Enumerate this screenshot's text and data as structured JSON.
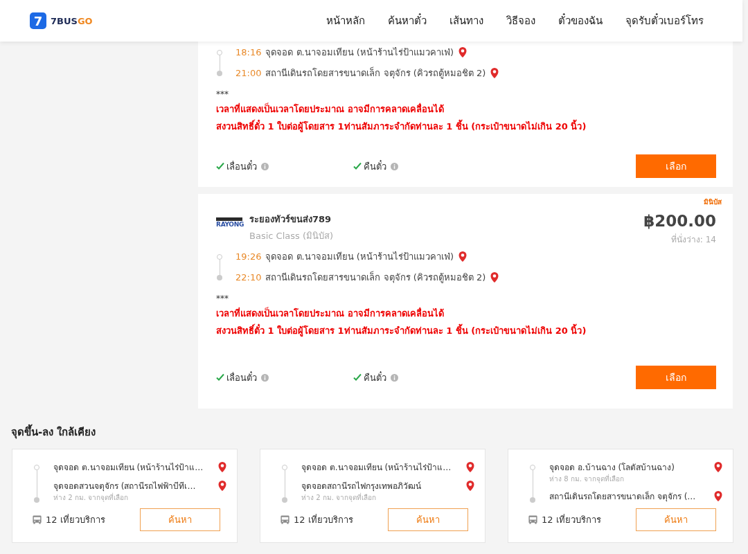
{
  "header": {
    "logo": {
      "mark": "7",
      "name_a": "7BUS",
      "name_b": "GO"
    },
    "nav": [
      "หน้าหลัก",
      "ค้นหาตั๋ว",
      "เส้นทาง",
      "วิธีจอง",
      "ตั๋วของฉัน",
      "จุดรับตั๋วเบอร์โทร"
    ]
  },
  "trips": [
    {
      "stops": [
        {
          "kind": "origin",
          "time": "18:16",
          "name": "จุดจอด ต.นาจอมเทียน (หน้าร้านไร่ป้าแมวคาเฟ่)"
        },
        {
          "kind": "destination",
          "time": "21:00",
          "name": "สถานีเดินรถโดยสารขนาดเล็ก จตุจักร (คิวรถตู้หมอชิต 2)"
        }
      ],
      "note_mark": "***",
      "notes": [
        "เวลาที่แสดงเป็นเวลาโดยประมาณ อาจมีการคลาดเคลื่อนได้",
        "สงวนสิทธิ์ตั๋ว 1 ใบต่อผู้โดยสาร 1ท่านสัมภาระจำกัดท่านละ 1 ชิ้น (กระเป๋าขนาดไม่เกิน 20 นิ้ว)"
      ],
      "features": [
        {
          "label": "เลื่อนตั๋ว",
          "available": true
        },
        {
          "label": "คืนตั๋ว",
          "available": true
        }
      ],
      "button": "เลือก"
    },
    {
      "badge": "มินิบัส",
      "operator_logo": "RAYONG",
      "operator": "ระยองทัวร์ขนส่ง789",
      "class": "Basic Class (มินิบัส)",
      "price": "฿200.00",
      "seats": "ที่นั่งว่าง: 14",
      "stops": [
        {
          "kind": "origin",
          "time": "19:26",
          "name": "จุดจอด ต.นาจอมเทียน (หน้าร้านไร่ป้าแมวคาเฟ่)"
        },
        {
          "kind": "destination",
          "time": "22:10",
          "name": "สถานีเดินรถโดยสารขนาดเล็ก จตุจักร (คิวรถตู้หมอชิต 2)"
        }
      ],
      "note_mark": "***",
      "notes": [
        "เวลาที่แสดงเป็นเวลาโดยประมาณ อาจมีการคลาดเคลื่อนได้",
        "สงวนสิทธิ์ตั๋ว 1 ใบต่อผู้โดยสาร 1ท่านสัมภาระจำกัดท่านละ 1 ชิ้น (กระเป๋าขนาดไม่เกิน 20 นิ้ว)"
      ],
      "features": [
        {
          "label": "เลื่อนตั๋ว",
          "available": true
        },
        {
          "label": "คืนตั๋ว",
          "available": true
        }
      ],
      "button": "เลือก"
    }
  ],
  "nearby": {
    "title": "จุดขึ้น-ลง ใกล้เคียง",
    "cards": [
      {
        "stops": [
          {
            "kind": "origin",
            "name": "จุดจอด ต.นาจอมเทียน (หน้าร้านไร่ป้าแ…"
          },
          {
            "kind": "destination",
            "name": "จุดจอดสวนจตุจักร (สถานีรถไฟฟ้าบีทีเ…",
            "distance": "ห่าง 2 กม. จากจุดที่เลือก"
          }
        ],
        "trips": "12 เที่ยวบริการ",
        "button": "ค้นหา"
      },
      {
        "stops": [
          {
            "kind": "origin",
            "name": "จุดจอด ต.นาจอมเทียน (หน้าร้านไร่ป้าแ…"
          },
          {
            "kind": "destination",
            "name": "จุดจอดสถานีรถไฟกรุงเทพอภิวัฒน์",
            "distance": "ห่าง 2 กม. จากจุดที่เลือก"
          }
        ],
        "trips": "12 เที่ยวบริการ",
        "button": "ค้นหา"
      },
      {
        "stops": [
          {
            "kind": "origin",
            "name": "จุดจอด อ.บ้านฉาง (โลตัสบ้านฉาง)",
            "distance": "ห่าง 8 กม. จากจุดที่เลือก"
          },
          {
            "kind": "destination",
            "name": "สถานีเดินรถโดยสารขนาดเล็ก จตุจักร (…"
          }
        ],
        "trips": "12 เที่ยวบริการ",
        "button": "ค้นหา"
      }
    ]
  }
}
